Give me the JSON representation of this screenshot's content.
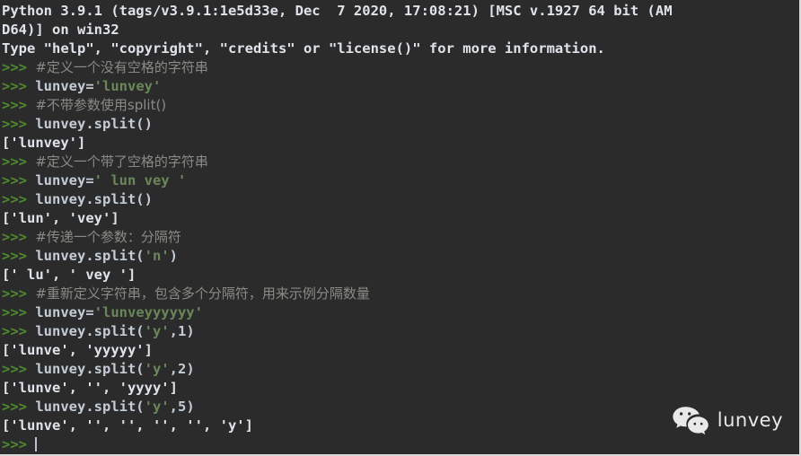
{
  "terminal": {
    "title": "Python 3.9.1 Shell",
    "colors": {
      "background": "#2b2b2b",
      "prompt": "#4e8a2e",
      "output": "#dfe4ea",
      "code": "#c3ccd6",
      "string": "#6a8759",
      "comment": "#8a8a85",
      "caret": "#b9c2cc",
      "border": "#d8d8d8"
    },
    "prompt_symbol": ">>>",
    "banner": [
      "Python 3.9.1 (tags/v3.9.1:1e5d33e, Dec  7 2020, 17:08:21) [MSC v.1927 64 bit (AM",
      "D64)] on win32",
      "Type \"help\", \"copyright\", \"credits\" or \"license()\" for more information."
    ],
    "lines": [
      {
        "kind": "banner",
        "text": "Python 3.9.1 (tags/v3.9.1:1e5d33e, Dec  7 2020, 17:08:21) [MSC v.1927 64 bit (AM"
      },
      {
        "kind": "banner",
        "text": "D64)] on win32"
      },
      {
        "kind": "banner",
        "text": "Type \"help\", \"copyright\", \"credits\" or \"license()\" for more information."
      },
      {
        "kind": "comment",
        "text": "#定义一个没有空格的字符串"
      },
      {
        "kind": "input",
        "code": "lunvey=",
        "str": "'lunvey'",
        "tail": ""
      },
      {
        "kind": "comment",
        "text": "#不带参数使用split()"
      },
      {
        "kind": "input",
        "code": "lunvey.split()",
        "str": "",
        "tail": ""
      },
      {
        "kind": "output",
        "text": "['lunvey']"
      },
      {
        "kind": "comment",
        "text": "#定义一个带了空格的字符串"
      },
      {
        "kind": "input",
        "code": "lunvey=",
        "str": "' lun vey '",
        "tail": ""
      },
      {
        "kind": "input",
        "code": "lunvey.split()",
        "str": "",
        "tail": ""
      },
      {
        "kind": "output",
        "text": "['lun', 'vey']"
      },
      {
        "kind": "comment",
        "text": "#传递一个参数：分隔符"
      },
      {
        "kind": "input",
        "code": "lunvey.split(",
        "str": "'n'",
        "tail": ")"
      },
      {
        "kind": "output",
        "text": "[' lu', ' vey ']"
      },
      {
        "kind": "comment",
        "text": "#重新定义字符串，包含多个分隔符，用来示例分隔数量"
      },
      {
        "kind": "input",
        "code": "lunvey=",
        "str": "'lunveyyyyyy'",
        "tail": ""
      },
      {
        "kind": "input",
        "code": "lunvey.split(",
        "str": "'y'",
        "tail": ",1)"
      },
      {
        "kind": "output",
        "text": "['lunve', 'yyyyy']"
      },
      {
        "kind": "input",
        "code": "lunvey.split(",
        "str": "'y'",
        "tail": ",2)"
      },
      {
        "kind": "output",
        "text": "['lunve', '', 'yyyy']"
      },
      {
        "kind": "input",
        "code": "lunvey.split(",
        "str": "'y'",
        "tail": ",5)"
      },
      {
        "kind": "output",
        "text": "['lunve', '', '', '', '', 'y']"
      },
      {
        "kind": "caret",
        "text": ""
      }
    ]
  },
  "watermark": {
    "icon_name": "wechat-icon",
    "label": "lunvey",
    "color": "#e8e8e8"
  }
}
